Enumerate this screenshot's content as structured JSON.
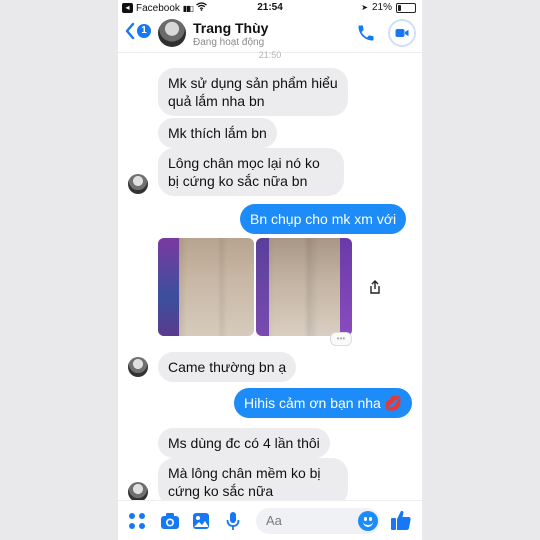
{
  "status_bar": {
    "carrier": "Facebook",
    "time": "21:54",
    "battery": "21%",
    "battery_level": 0.21
  },
  "header": {
    "back_count": "1",
    "contact_name": "Trang Thùy",
    "presence": "Đang hoạt động"
  },
  "timestamp": "21:50",
  "messages": [
    {
      "from": "contact",
      "text": "Mk sử dụng sản phẩm hiểu quả lắm nha bn"
    },
    {
      "from": "contact",
      "text": "Mk thích lắm bn"
    },
    {
      "from": "contact",
      "text": "Lông chân mọc lại nó ko bị cứng ko sắc nữa bn"
    },
    {
      "from": "me",
      "text": "Bn chụp cho mk xm với"
    },
    {
      "from": "contact",
      "type": "photos",
      "count": 2
    },
    {
      "from": "contact",
      "text": "Came thường bn ạ"
    },
    {
      "from": "me",
      "text": "Hihis cảm ơn bạn nha 💋"
    },
    {
      "from": "contact",
      "text": "Ms dùng đc có 4 lần thôi"
    },
    {
      "from": "contact",
      "text": "Mà lông chân mềm ko bị cứng ko sắc nữa"
    }
  ],
  "composer": {
    "placeholder": "Aa"
  },
  "colors": {
    "accent": "#1d8cf8",
    "incoming_bubble": "#ececef",
    "outgoing_text": "#ffffff"
  },
  "icons": [
    "back-chevron-icon",
    "phone-icon",
    "video-camera-icon",
    "share-icon",
    "more-dots-icon",
    "camera-icon",
    "image-icon",
    "microphone-icon",
    "emoji-icon",
    "thumbs-up-icon"
  ]
}
